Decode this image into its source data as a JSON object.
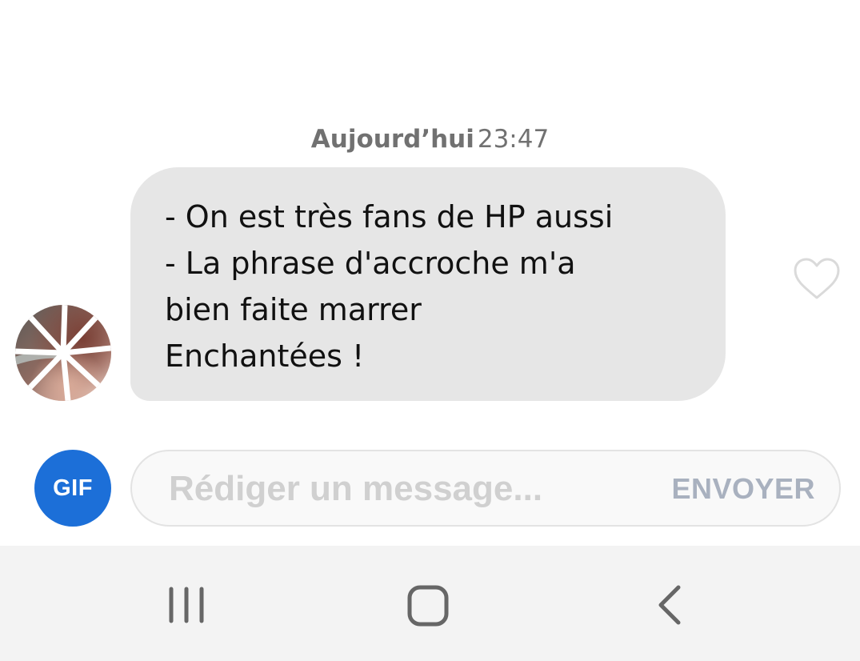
{
  "conversation": {
    "timestamp_day": "Aujourd’hui",
    "timestamp_time": "23:47"
  },
  "message": {
    "lines": [
      "- On est très fans de HP aussi",
      "- La phrase d'accroche m'a",
      "bien faite marrer",
      "Enchantées !"
    ],
    "like_icon": "heart-outline-icon",
    "avatar": "contact-avatar-photo"
  },
  "composer": {
    "gif_label": "GIF",
    "placeholder": "Rédiger un message...",
    "value": "",
    "send_label": "ENVOYER"
  },
  "navbar": {
    "icons": [
      "recents-icon",
      "home-icon",
      "back-icon"
    ]
  },
  "colors": {
    "bubble": "#e6e6e6",
    "gif_button": "#1c6fd8",
    "send_label": "#a9b1bf",
    "timestamp": "#717171",
    "navbar": "#f3f3f3"
  }
}
